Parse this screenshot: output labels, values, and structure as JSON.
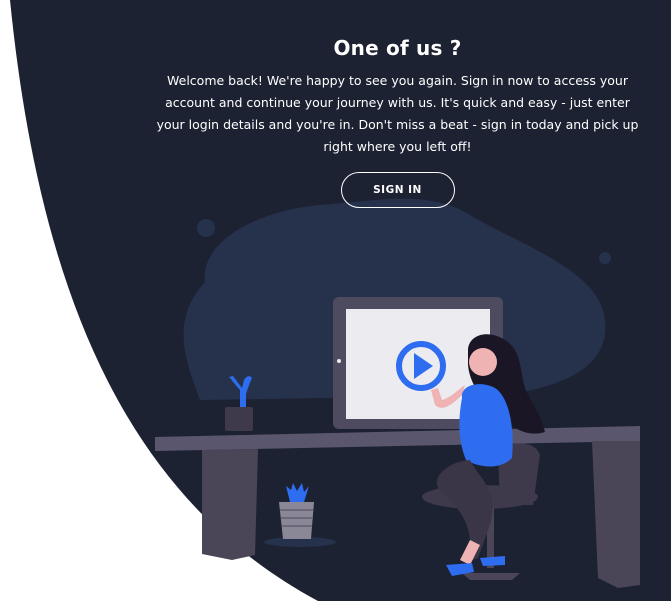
{
  "panel": {
    "title": "One of us ?",
    "description": "Welcome back! We're happy to see you again. Sign in now to access your account and continue your journey with us. It's quick and easy - just enter your login details and you're in. Don't miss a beat - sign in today and pick up right where you left off!",
    "signin_label": "SIGN IN"
  },
  "colors": {
    "panel_bg": "#1c2232",
    "blob": "#26314c",
    "accent": "#2e6cf0",
    "screen": "#ececf0",
    "desk": "#5a566e"
  },
  "icons": {
    "video": "play-icon"
  }
}
